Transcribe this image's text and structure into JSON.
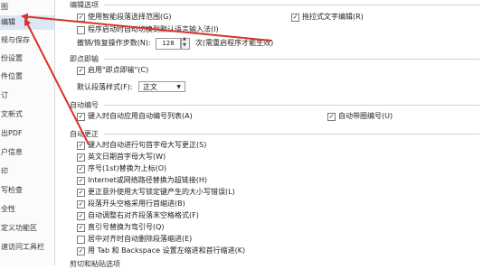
{
  "sidebar": {
    "items": [
      {
        "label": "图"
      },
      {
        "label": "编辑",
        "selected": true
      },
      {
        "label": "规与保存"
      },
      {
        "label": "份设置"
      },
      {
        "label": "件位置"
      },
      {
        "label": "订"
      },
      {
        "label": "文新式"
      },
      {
        "label": "出PDF"
      },
      {
        "label": "户信息"
      },
      {
        "label": "印"
      },
      {
        "label": "写检查"
      },
      {
        "label": "全性"
      },
      {
        "label": "定义功能区"
      },
      {
        "label": "速访问工具栏"
      }
    ]
  },
  "sections": {
    "edit": {
      "title": "编辑选项",
      "smart_select": {
        "label": "使用智能段落选择范围(G)",
        "checked": true
      },
      "drag_drop": {
        "label": "拖拉式文字编辑(R)",
        "checked": true
      },
      "ime_switch": {
        "label": "程序启动时自动切换到默认语言输入法(I)",
        "checked": false
      },
      "undo_label": "撤销/恢复操作步数(N):",
      "undo_value": "128",
      "undo_suffix": "次(需重启程序才能生效)"
    },
    "instant": {
      "title": "即点即输",
      "enable": {
        "label": "启用\"即点即输\"(C)",
        "checked": true
      },
      "style_label": "默认段落样式(F):",
      "style_value": "正文"
    },
    "autonum": {
      "title": "自动编号",
      "auto_list": {
        "label": "键入时自动应用自动编号列表(A)",
        "checked": true
      },
      "tab_indent": {
        "label": "自动带圈编号(U)",
        "checked": true
      }
    },
    "autocorrect": {
      "title": "自动更正",
      "items": [
        {
          "label": "键入时自动进行句首字母大写更正(S)",
          "checked": true
        },
        {
          "label": "英文日期首字母大写(W)",
          "checked": true
        },
        {
          "label": "序号(1st)替换为上标(O)",
          "checked": true
        },
        {
          "label": "Internet或网络路径替换为超链接(H)",
          "checked": true
        },
        {
          "label": "更正意外使用大写锁定键产生的大小写错误(L)",
          "checked": true
        },
        {
          "label": "段落开头空格采用行首缩进(B)",
          "checked": true
        },
        {
          "label": "自动调整右对齐段落末空格格式(F)",
          "checked": true
        },
        {
          "label": "直引号替换为弯引号(Q)",
          "checked": true
        },
        {
          "label": "居中对齐时自动删除段落缩进(E)",
          "checked": false
        },
        {
          "label": "用 Tab 和 Backspace 设置左缩进和首行缩进(K)",
          "checked": true
        }
      ],
      "cut_label": "剪切和粘贴选项"
    }
  },
  "annotations": {
    "arrow_color": "#d9322b"
  }
}
